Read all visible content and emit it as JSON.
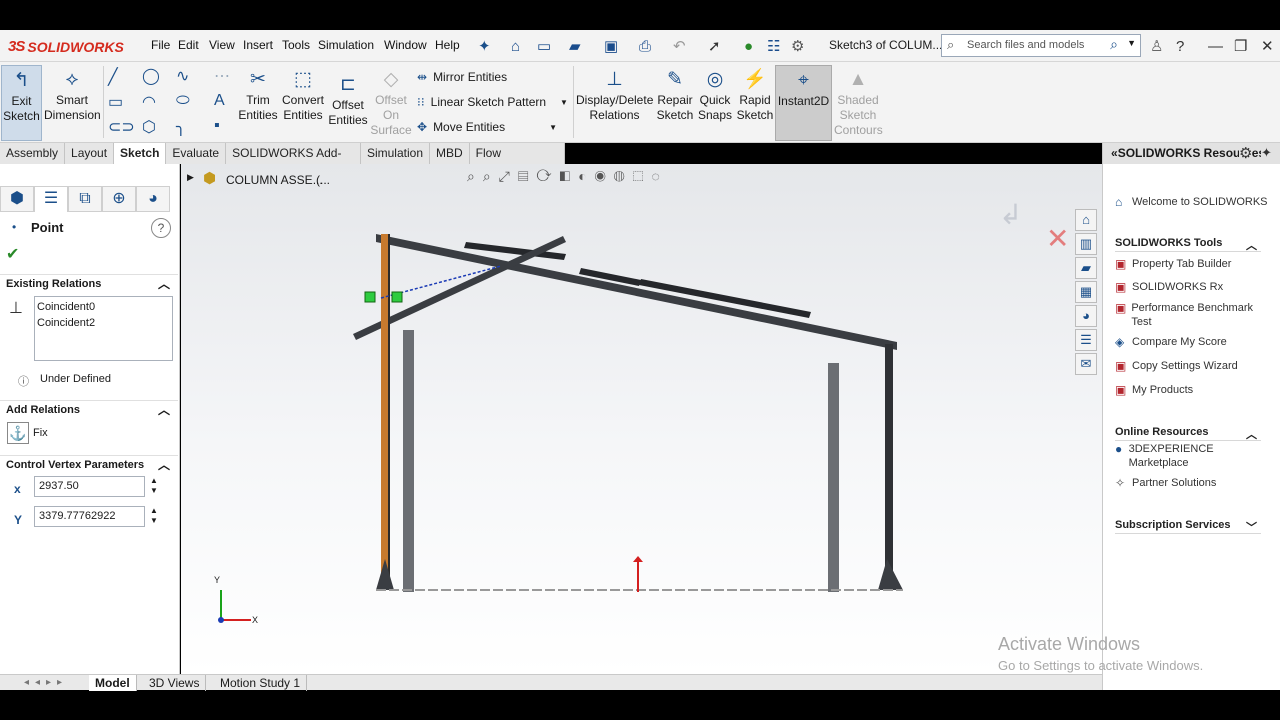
{
  "app": {
    "logo": "SOLIDWORKS",
    "logo_prefix": "3S",
    "document_title": "Sketch3 of COLUM...",
    "search_placeholder": "Search files and models"
  },
  "menu": [
    "File",
    "Edit",
    "View",
    "Insert",
    "Tools",
    "Simulation",
    "Window",
    "Help"
  ],
  "ribbon": {
    "exit_sketch": "Exit\nSketch",
    "smart_dimension": "Smart\nDimension",
    "trim_entities": "Trim\nEntities",
    "convert_entities": "Convert\nEntities",
    "offset_entities": "Offset\nEntities",
    "offset_on_surface": "Offset\nOn\nSurface",
    "mirror_entities": "Mirror Entities",
    "linear_sketch_pattern": "Linear Sketch Pattern",
    "move_entities": "Move Entities",
    "display_delete_relations": "Display/Delete\nRelations",
    "repair_sketch": "Repair\nSketch",
    "quick_snaps": "Quick\nSnaps",
    "rapid_sketch": "Rapid\nSketch",
    "instant2d": "Instant2D",
    "shaded_sketch_contours": "Shaded\nSketch\nContours"
  },
  "command_tabs": [
    {
      "label": "Assembly",
      "active": false
    },
    {
      "label": "Layout",
      "active": false
    },
    {
      "label": "Sketch",
      "active": true
    },
    {
      "label": "Evaluate",
      "active": false
    },
    {
      "label": "SOLIDWORKS Add-Ins",
      "active": false
    },
    {
      "label": "Simulation",
      "active": false
    },
    {
      "label": "MBD",
      "active": false
    },
    {
      "label": "Flow Simulation",
      "active": false
    }
  ],
  "property_manager": {
    "title": "Point",
    "existing_relations_title": "Existing Relations",
    "relations": [
      "Coincident0",
      "Coincident2"
    ],
    "status": "Under Defined",
    "add_relations_title": "Add Relations",
    "fix_label": "Fix",
    "control_vertex_title": "Control Vertex Parameters",
    "x_value": "2937.50",
    "y_value": "3379.77762922",
    "x_label": "x",
    "y_label": "Y"
  },
  "viewport": {
    "tree_label": "COLUMN ASSE...",
    "tree_suffix": "(...",
    "triad_x": "X",
    "triad_y": "Y"
  },
  "bottom_tabs": [
    {
      "label": "Model",
      "active": true
    },
    {
      "label": "3D Views",
      "active": false
    },
    {
      "label": "Motion Study 1",
      "active": false
    }
  ],
  "resources": {
    "header": "SOLIDWORKS Resources",
    "welcome": "Welcome to SOLIDWORKS",
    "tools_title": "SOLIDWORKS Tools",
    "tools": [
      "Property Tab Builder",
      "SOLIDWORKS Rx",
      "Performance Benchmark Test",
      "Compare My Score",
      "Copy Settings Wizard",
      "My Products"
    ],
    "online_title": "Online Resources",
    "online": [
      "3DEXPERIENCE Marketplace",
      "Partner Solutions"
    ],
    "subscription_title": "Subscription Services"
  },
  "watermark": {
    "line1": "Activate Windows",
    "line2": "Go to Settings to activate Windows."
  },
  "colors": {
    "brand": "#d52b1e",
    "accent": "#1b4f8a",
    "active_tab": "#ffffff",
    "column_orange": "#c77a2e",
    "beam": "#3a3d42"
  }
}
